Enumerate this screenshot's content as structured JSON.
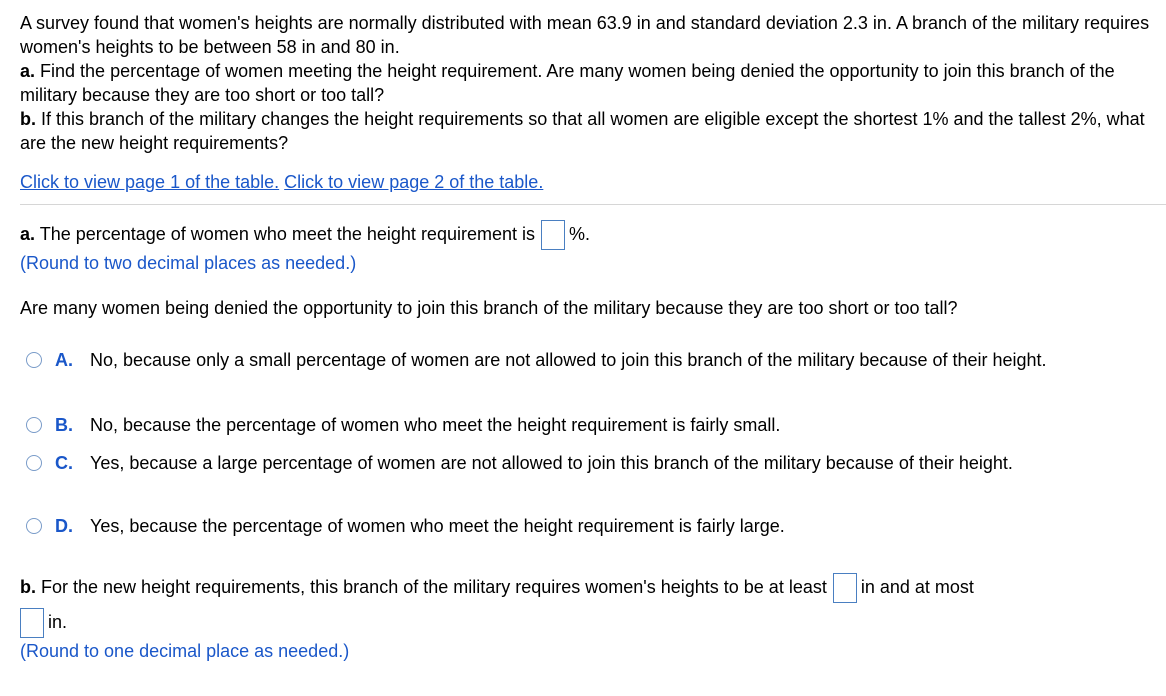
{
  "problem": {
    "intro": "A survey found that women's heights are normally distributed with mean 63.9 in and standard deviation 2.3 in. A branch of the military requires women's heights to be between 58 in and 80 in.",
    "part_a_label": "a.",
    "part_a_text": "Find the percentage of women meeting the height requirement. Are many women being denied the opportunity to join this branch of the military because they are too short or too tall?",
    "part_b_label": "b.",
    "part_b_text": "If this branch of the military changes the height requirements so that all women are eligible except the shortest 1% and the tallest 2%, what are the new height requirements?"
  },
  "links": {
    "page1": "Click to view page 1 of the table.",
    "page2": "Click to view page 2 of the table."
  },
  "answer_a": {
    "label": "a.",
    "text_before": "The percentage of women who meet the height requirement is",
    "value": "",
    "unit": "%.",
    "round_hint": "(Round to two decimal places as needed.)"
  },
  "question": "Are many women being denied the opportunity to join this branch of the military because they are too short or too tall?",
  "options": [
    {
      "letter": "A.",
      "text": "No, because only a small percentage of women are not allowed to join this branch of the military because of their height."
    },
    {
      "letter": "B.",
      "text": "No, because the percentage of women who meet the height requirement is fairly small."
    },
    {
      "letter": "C.",
      "text": "Yes, because a large percentage of women are not allowed to join this branch of the military because of their height."
    },
    {
      "letter": "D.",
      "text": "Yes, because the percentage of women who meet the height requirement is fairly large."
    }
  ],
  "answer_b": {
    "label": "b.",
    "text_before": "For the new height requirements, this branch of the military requires women's heights to be at least",
    "between": "in and at most",
    "unit": "in.",
    "least_value": "",
    "most_value": "",
    "round_hint": "(Round to one decimal place as needed.)"
  },
  "colors": {
    "link": "#1a57c9",
    "input_border": "#4a7fc1",
    "divider": "#d6d6d6"
  }
}
